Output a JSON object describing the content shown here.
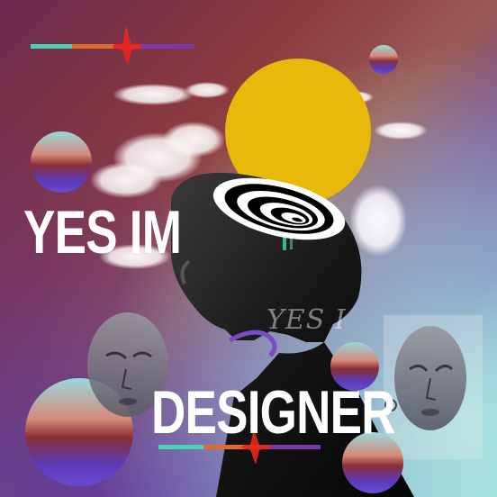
{
  "poster": {
    "headline_top": "YES IM",
    "headline_bottom": "DESIGNER",
    "watermark_text": "YES I"
  },
  "colors": {
    "sun": "#e8b80a",
    "text": "#ffffff",
    "orb_top": "#8fd6d8",
    "orb_mid": "#8a3a3a",
    "orb_bottom": "#5a3ab0",
    "stripe_teal": "#47d3b4",
    "stripe_orange": "#e06a2a",
    "stripe_red": "#e8281e",
    "stripe_purple": "#7a3aa8"
  },
  "icons": [
    "ghanaian-mask-left",
    "ghanaian-mask-right",
    "spiral-hypnotic",
    "head-silhouette",
    "cloud"
  ]
}
